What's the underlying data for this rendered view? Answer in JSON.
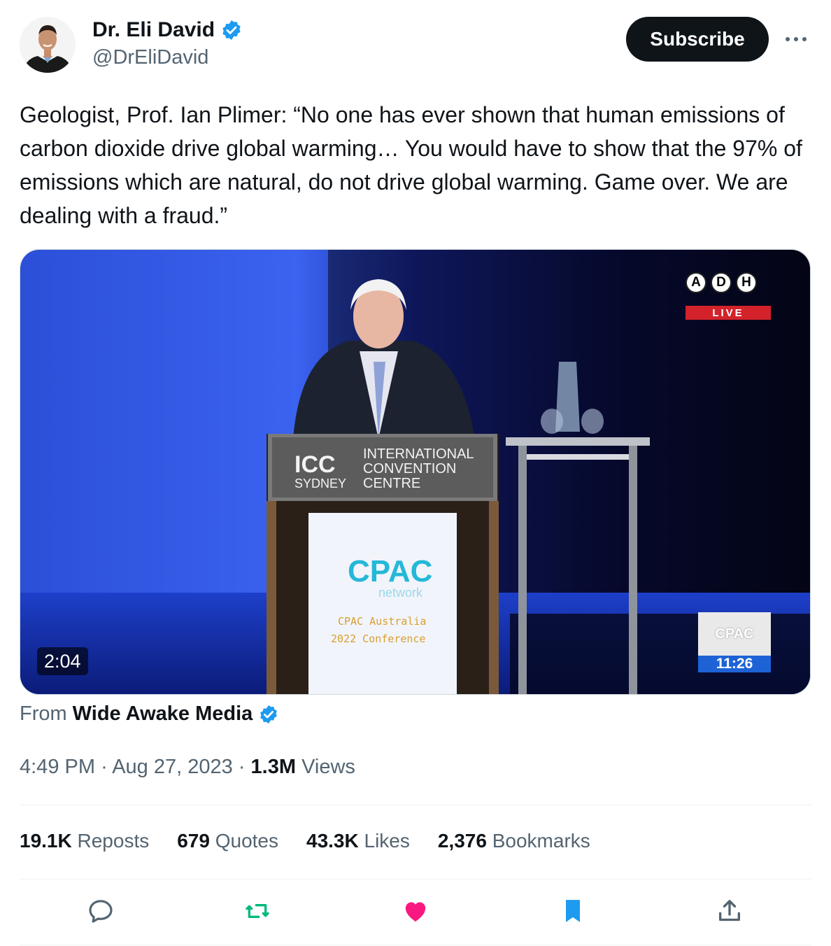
{
  "author": {
    "name": "Dr. Eli David",
    "handle": "@DrEliDavid",
    "verified": true
  },
  "subscribe_label": "Subscribe",
  "tweet_text": "Geologist, Prof. Ian Plimer: “No one has ever shown that human emissions of carbon dioxide drive global warming… You would have to show that the 97% of emissions which are natural, do not drive global warming. Game over. We are dealing with a fraud.”",
  "media": {
    "duration": "2:04",
    "broadcaster_letters": [
      "A",
      "D",
      "H"
    ],
    "live_label": "LIVE",
    "lectern_logo": "ICC",
    "lectern_lines": [
      "INTERNATIONAL",
      "CONVENTION",
      "SYDNEY",
      "CENTRE"
    ],
    "sign_logo": "CPAC",
    "sign_network": "network",
    "sign_line1": "CPAC Australia",
    "sign_line2": "2022 Conference",
    "corner_logo": "CPAC",
    "corner_time": "11:26"
  },
  "source": {
    "prefix": "From",
    "name": "Wide Awake Media",
    "verified": true
  },
  "meta": {
    "time": "4:49 PM",
    "date": "Aug 27, 2023",
    "views_count": "1.3M",
    "views_label": "Views"
  },
  "stats": {
    "reposts_count": "19.1K",
    "reposts_label": "Reposts",
    "quotes_count": "679",
    "quotes_label": "Quotes",
    "likes_count": "43.3K",
    "likes_label": "Likes",
    "bookmarks_count": "2,376",
    "bookmarks_label": "Bookmarks"
  },
  "icons": {
    "reply": "reply-icon",
    "repost": "repost-icon",
    "like": "heart-icon",
    "bookmark": "bookmark-icon",
    "share": "share-icon",
    "more": "more-icon",
    "verified": "verified-badge-icon"
  },
  "colors": {
    "text": "#0f1419",
    "secondary": "#536471",
    "verified": "#1d9bf0",
    "repost": "#00ba7c",
    "like": "#f91880",
    "bookmark": "#1d9bf0"
  }
}
